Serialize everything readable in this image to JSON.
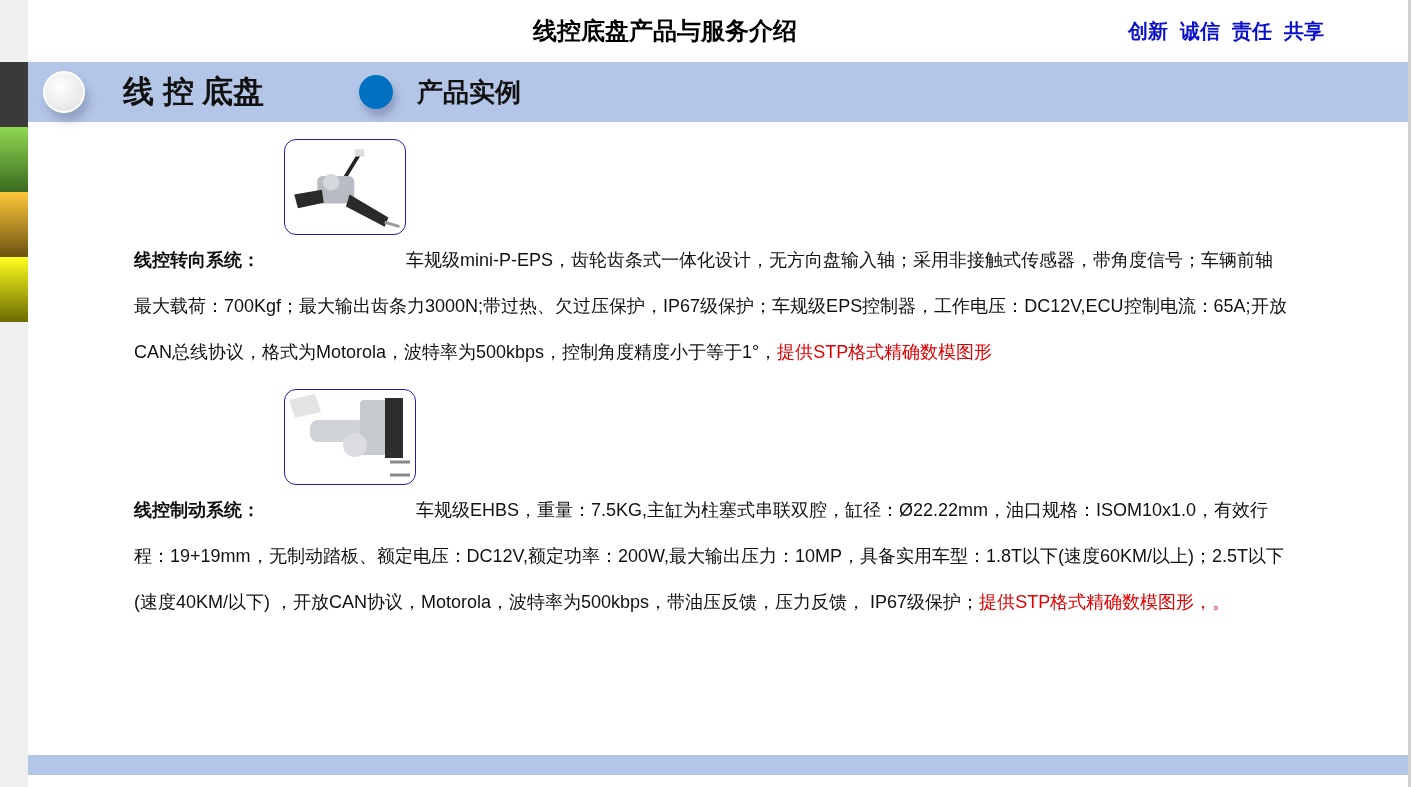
{
  "title": "线控底盘产品与服务介绍",
  "slogans": [
    "创新",
    "诚信",
    "责任",
    "共享"
  ],
  "band": {
    "section": "线 控 底盘",
    "subsection": "产品实例"
  },
  "systems": [
    {
      "label": "线控转向系统：",
      "body": "车规级mini-P-EPS，齿轮齿条式一体化设计，无方向盘输入轴；采用非接触式传感器，带角度信号；车辆前轴最大载荷：700Kgf；最大输出齿条力3000N;带过热、欠过压保护，IP67级保护；车规级EPS控制器，工作电压：DC12V,ECU控制电流：65A;开放CAN总线协议，格式为Motorola，波特率为500kbps，控制角度精度小于等于1°，",
      "note": "提供STP格式精确数模图形"
    },
    {
      "label": "线控制动系统：",
      "body": "车规级EHBS，重量：7.5KG,主缸为柱塞式串联双腔，缸径：Ø22.22mm，油口规格：ISOM10x1.0，有效行程：19+19mm，无制动踏板、额定电压：DC12V,额定功率：200W,最大输出压力：10MP，具备实用车型：1.8T以下(速度60KM/以上)；2.5T以下  (速度40KM/以下) ，开放CAN协议，Motorola，波特率为500kbps，带油压反馈，压力反馈， IP67级保护；",
      "note": "提供STP格式精确数模图形，。"
    }
  ]
}
